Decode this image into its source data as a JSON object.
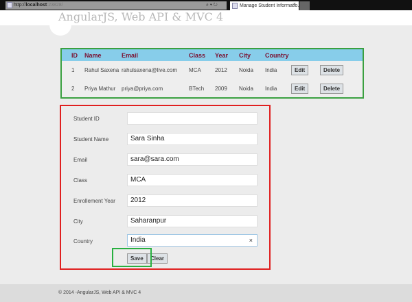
{
  "browser": {
    "url_prefix": "http://",
    "url_host": "localhost",
    "url_port": ":23828/",
    "tools": "⌕ ▾ ↻",
    "tab_title": "Manage Student Informatio...",
    "tab_close": "×"
  },
  "header": {
    "title": "AngularJS, Web API & MVC 4"
  },
  "table": {
    "columns": [
      "ID",
      "Name",
      "Email",
      "Class",
      "Year",
      "City",
      "Country"
    ],
    "rows": [
      {
        "id": "1",
        "name": "Rahul Saxena",
        "email": "rahulsaxena@live.com",
        "class": "MCA",
        "year": "2012",
        "city": "Noida",
        "country": "India"
      },
      {
        "id": "2",
        "name": "Priya Mathur",
        "email": "priya@priya.com",
        "class": "BTech",
        "year": "2009",
        "city": "Noida",
        "country": "India"
      }
    ],
    "edit_label": "Edit",
    "delete_label": "Delete"
  },
  "form": {
    "fields": [
      {
        "label": "Student ID",
        "value": ""
      },
      {
        "label": "Student Name",
        "value": "Sara Sinha"
      },
      {
        "label": "Email",
        "value": "sara@sara.com"
      },
      {
        "label": "Class",
        "value": "MCA"
      },
      {
        "label": "Enrollement Year",
        "value": "2012"
      },
      {
        "label": "City",
        "value": "Saharanpur"
      },
      {
        "label": "Country",
        "value": "India"
      }
    ],
    "clear_x": "×",
    "save_label": "Save",
    "clear_label": "Clear"
  },
  "footer": {
    "text": "© 2014 -AngularJS, Web API & MVC 4"
  }
}
